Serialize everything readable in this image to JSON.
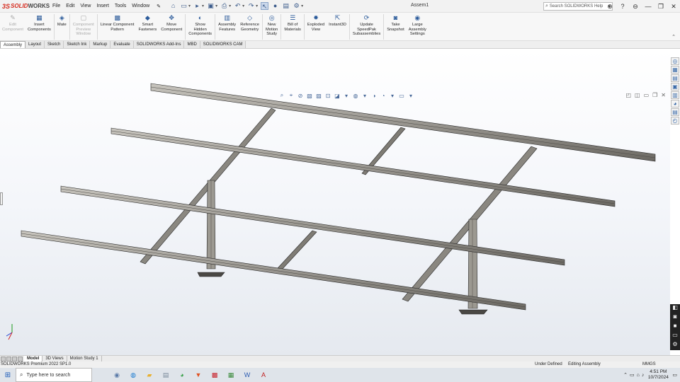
{
  "app": {
    "brand_prefix": "3S",
    "brand_name": "SOLID",
    "brand_suffix": "WORKS",
    "document_title": "Assem1",
    "search_placeholder": "Search SOLIDWORKS Help"
  },
  "menu": [
    "File",
    "Edit",
    "View",
    "Insert",
    "Tools",
    "Window"
  ],
  "quick_access": [
    {
      "name": "home-icon",
      "glyph": "⌂"
    },
    {
      "name": "new-icon",
      "glyph": "▭"
    },
    {
      "name": "open-icon",
      "glyph": "▸"
    },
    {
      "name": "save-icon",
      "glyph": "▣"
    },
    {
      "name": "print-icon",
      "glyph": "⎙"
    },
    {
      "name": "undo-icon",
      "glyph": "↶"
    },
    {
      "name": "redo-icon",
      "glyph": "↷"
    },
    {
      "name": "select-icon",
      "glyph": "↖"
    },
    {
      "name": "rebuild-icon",
      "glyph": "●"
    },
    {
      "name": "file-properties-icon",
      "glyph": "▤"
    },
    {
      "name": "options-icon",
      "glyph": "⚙"
    }
  ],
  "window_controls": [
    "⊕",
    "?",
    "⊖",
    "—",
    "❐",
    "✕"
  ],
  "ribbon": [
    {
      "label": "Edit\nComponent",
      "icon": "edit-component-icon",
      "glyph": "✎",
      "disabled": true
    },
    {
      "label": "Insert\nComponents",
      "icon": "insert-components-icon",
      "glyph": "▦",
      "disabled": false
    },
    {
      "label": "Mate",
      "icon": "mate-icon",
      "glyph": "◈",
      "disabled": false
    },
    {
      "label": "Component\nPreview\nWindow",
      "icon": "component-preview-icon",
      "glyph": "▢",
      "disabled": true
    },
    {
      "label": "Linear Component\nPattern",
      "icon": "linear-pattern-icon",
      "glyph": "▩",
      "disabled": false
    },
    {
      "label": "Smart\nFasteners",
      "icon": "smart-fasteners-icon",
      "glyph": "◆",
      "disabled": false
    },
    {
      "label": "Move\nComponent",
      "icon": "move-component-icon",
      "glyph": "✥",
      "disabled": false
    },
    {
      "label": "Show\nHidden\nComponents",
      "icon": "show-hidden-icon",
      "glyph": "◐",
      "disabled": false
    },
    {
      "label": "Assembly\nFeatures",
      "icon": "assembly-features-icon",
      "glyph": "▥",
      "disabled": false
    },
    {
      "label": "Reference\nGeometry",
      "icon": "reference-geometry-icon",
      "glyph": "◇",
      "disabled": false
    },
    {
      "label": "New\nMotion\nStudy",
      "icon": "motion-study-icon",
      "glyph": "◎",
      "disabled": false
    },
    {
      "label": "Bill of\nMaterials",
      "icon": "bom-icon",
      "glyph": "☰",
      "disabled": false
    },
    {
      "label": "Exploded\nView",
      "icon": "exploded-view-icon",
      "glyph": "✸",
      "disabled": false
    },
    {
      "label": "Instant3D",
      "icon": "instant3d-icon",
      "glyph": "⇱",
      "disabled": false
    },
    {
      "label": "Update\nSpeedPak\nSubassemblies",
      "icon": "speedpak-icon",
      "glyph": "⟳",
      "disabled": false
    },
    {
      "label": "Take\nSnapshot",
      "icon": "snapshot-icon",
      "glyph": "◙",
      "disabled": false
    },
    {
      "label": "Large\nAssembly\nSettings",
      "icon": "large-assembly-icon",
      "glyph": "◉",
      "disabled": false
    }
  ],
  "tabs": [
    "Assembly",
    "Layout",
    "Sketch",
    "Sketch Ink",
    "Markup",
    "Evaluate",
    "SOLIDWORKS Add-Ins",
    "MBD",
    "SOLIDWORKS CAM"
  ],
  "active_tab": "Assembly",
  "hud": [
    "⌕",
    "⌖",
    "⊘",
    "▧",
    "▨",
    "⊡",
    "◪",
    "▾",
    "◍",
    "▾",
    "◑",
    "◔",
    "▾",
    "▭",
    "▾"
  ],
  "viewport_controls": [
    "◰",
    "◫",
    "▭",
    "❐",
    "✕"
  ],
  "taskpane_top": [
    "◎",
    "▦",
    "▤",
    "▣",
    "▥",
    "◕",
    "▤",
    "◴"
  ],
  "taskpane_bottom": [
    "◧",
    "◙",
    "■",
    "▭",
    "⚙"
  ],
  "bottom_tabs": [
    "Model",
    "3D Views",
    "Motion Study 1"
  ],
  "active_bottom_tab": "Model",
  "status": {
    "product": "SOLIDWORKS Premium 2022 SP1.0",
    "state": "Under Defined",
    "mode": "Editing Assembly",
    "units": "MMGS"
  },
  "taskbar": {
    "search_placeholder": "Type here to search",
    "apps": [
      "◉",
      "◍",
      "▰",
      "▤",
      "◕",
      "▼",
      "▩",
      "▦",
      "W",
      "A"
    ],
    "tray": [
      "⌃",
      "▭",
      "⌂",
      "♪"
    ],
    "time": "4:51 PM",
    "date": "10/7/2024"
  },
  "colors": {
    "brand_red": "#d52b1e",
    "steel_light": "#b4b1aa",
    "steel_dark": "#5e5b56",
    "edge": "#2a2a2a"
  }
}
